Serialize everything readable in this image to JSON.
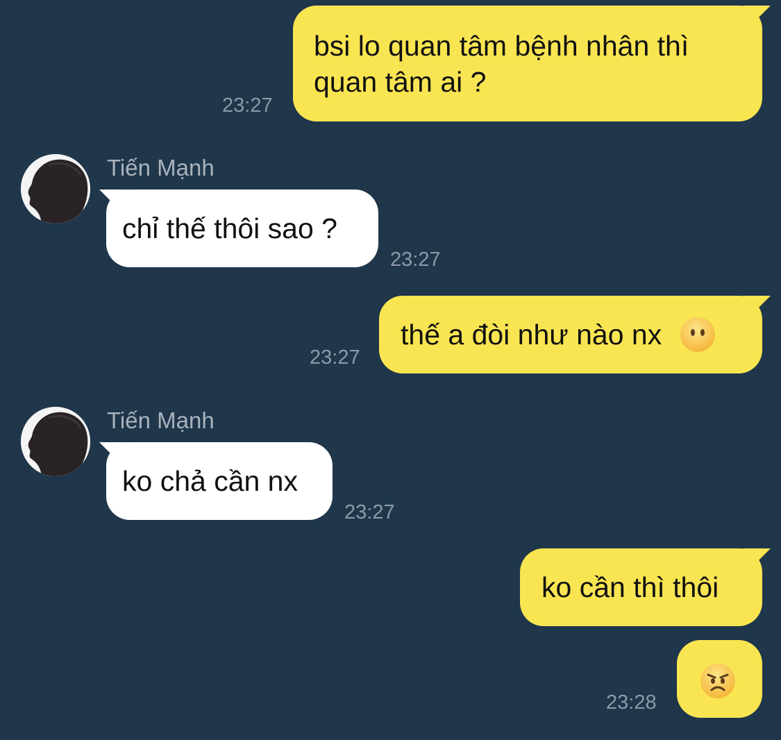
{
  "conversation": {
    "messages": [
      {
        "side": "out",
        "text": "bsi lo quan tâm bệnh nhân thì",
        "text2": "quan tâm ai ?",
        "time": "23:27"
      },
      {
        "side": "in",
        "sender": "Tiến Mạnh",
        "avatar": "contact-avatar",
        "text": "chỉ thế thôi sao ?",
        "time": "23:27"
      },
      {
        "side": "out",
        "text": "thế a đòi như nào nx",
        "emoji": "neutral-face-emoji",
        "time": "23:27"
      },
      {
        "side": "in",
        "sender": "Tiến Mạnh",
        "avatar": "contact-avatar",
        "text": "ko chả cần nx",
        "time": "23:27"
      },
      {
        "side": "out",
        "text": "ko cần thì thôi"
      },
      {
        "side": "out",
        "emoji": "angry-face-emoji",
        "time": "23:28"
      }
    ]
  },
  "colors": {
    "background": "#1f364b",
    "outgoing_bubble": "#f9e551",
    "incoming_bubble": "#ffffff",
    "timestamp": "#8d9aa7",
    "sender_name": "#a9b3bc"
  }
}
